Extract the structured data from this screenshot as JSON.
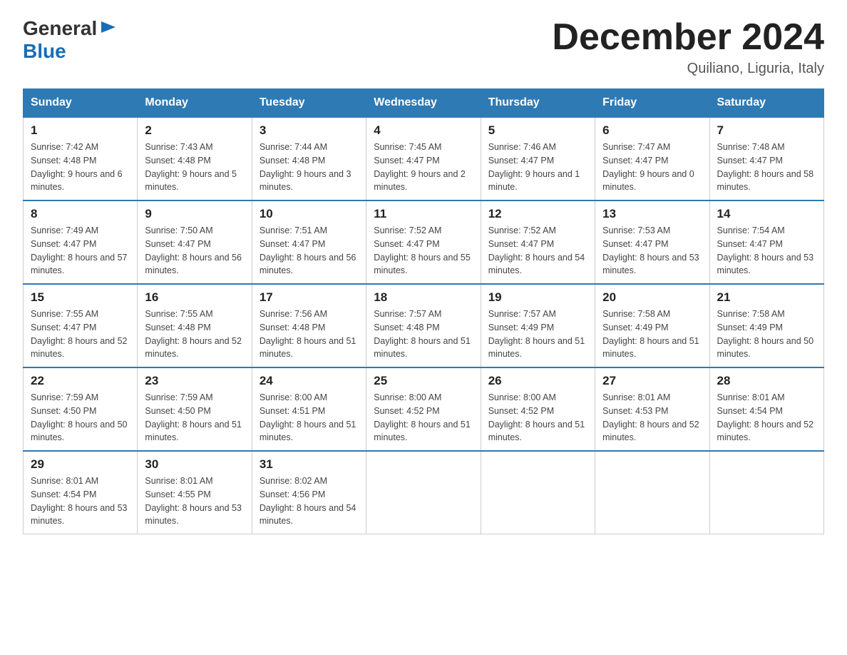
{
  "header": {
    "logo_general": "General",
    "logo_blue": "Blue",
    "month_title": "December 2024",
    "location": "Quiliano, Liguria, Italy"
  },
  "days_of_week": [
    "Sunday",
    "Monday",
    "Tuesday",
    "Wednesday",
    "Thursday",
    "Friday",
    "Saturday"
  ],
  "weeks": [
    [
      {
        "day": "1",
        "sunrise": "7:42 AM",
        "sunset": "4:48 PM",
        "daylight": "9 hours and 6 minutes."
      },
      {
        "day": "2",
        "sunrise": "7:43 AM",
        "sunset": "4:48 PM",
        "daylight": "9 hours and 5 minutes."
      },
      {
        "day": "3",
        "sunrise": "7:44 AM",
        "sunset": "4:48 PM",
        "daylight": "9 hours and 3 minutes."
      },
      {
        "day": "4",
        "sunrise": "7:45 AM",
        "sunset": "4:47 PM",
        "daylight": "9 hours and 2 minutes."
      },
      {
        "day": "5",
        "sunrise": "7:46 AM",
        "sunset": "4:47 PM",
        "daylight": "9 hours and 1 minute."
      },
      {
        "day": "6",
        "sunrise": "7:47 AM",
        "sunset": "4:47 PM",
        "daylight": "9 hours and 0 minutes."
      },
      {
        "day": "7",
        "sunrise": "7:48 AM",
        "sunset": "4:47 PM",
        "daylight": "8 hours and 58 minutes."
      }
    ],
    [
      {
        "day": "8",
        "sunrise": "7:49 AM",
        "sunset": "4:47 PM",
        "daylight": "8 hours and 57 minutes."
      },
      {
        "day": "9",
        "sunrise": "7:50 AM",
        "sunset": "4:47 PM",
        "daylight": "8 hours and 56 minutes."
      },
      {
        "day": "10",
        "sunrise": "7:51 AM",
        "sunset": "4:47 PM",
        "daylight": "8 hours and 56 minutes."
      },
      {
        "day": "11",
        "sunrise": "7:52 AM",
        "sunset": "4:47 PM",
        "daylight": "8 hours and 55 minutes."
      },
      {
        "day": "12",
        "sunrise": "7:52 AM",
        "sunset": "4:47 PM",
        "daylight": "8 hours and 54 minutes."
      },
      {
        "day": "13",
        "sunrise": "7:53 AM",
        "sunset": "4:47 PM",
        "daylight": "8 hours and 53 minutes."
      },
      {
        "day": "14",
        "sunrise": "7:54 AM",
        "sunset": "4:47 PM",
        "daylight": "8 hours and 53 minutes."
      }
    ],
    [
      {
        "day": "15",
        "sunrise": "7:55 AM",
        "sunset": "4:47 PM",
        "daylight": "8 hours and 52 minutes."
      },
      {
        "day": "16",
        "sunrise": "7:55 AM",
        "sunset": "4:48 PM",
        "daylight": "8 hours and 52 minutes."
      },
      {
        "day": "17",
        "sunrise": "7:56 AM",
        "sunset": "4:48 PM",
        "daylight": "8 hours and 51 minutes."
      },
      {
        "day": "18",
        "sunrise": "7:57 AM",
        "sunset": "4:48 PM",
        "daylight": "8 hours and 51 minutes."
      },
      {
        "day": "19",
        "sunrise": "7:57 AM",
        "sunset": "4:49 PM",
        "daylight": "8 hours and 51 minutes."
      },
      {
        "day": "20",
        "sunrise": "7:58 AM",
        "sunset": "4:49 PM",
        "daylight": "8 hours and 51 minutes."
      },
      {
        "day": "21",
        "sunrise": "7:58 AM",
        "sunset": "4:49 PM",
        "daylight": "8 hours and 50 minutes."
      }
    ],
    [
      {
        "day": "22",
        "sunrise": "7:59 AM",
        "sunset": "4:50 PM",
        "daylight": "8 hours and 50 minutes."
      },
      {
        "day": "23",
        "sunrise": "7:59 AM",
        "sunset": "4:50 PM",
        "daylight": "8 hours and 51 minutes."
      },
      {
        "day": "24",
        "sunrise": "8:00 AM",
        "sunset": "4:51 PM",
        "daylight": "8 hours and 51 minutes."
      },
      {
        "day": "25",
        "sunrise": "8:00 AM",
        "sunset": "4:52 PM",
        "daylight": "8 hours and 51 minutes."
      },
      {
        "day": "26",
        "sunrise": "8:00 AM",
        "sunset": "4:52 PM",
        "daylight": "8 hours and 51 minutes."
      },
      {
        "day": "27",
        "sunrise": "8:01 AM",
        "sunset": "4:53 PM",
        "daylight": "8 hours and 52 minutes."
      },
      {
        "day": "28",
        "sunrise": "8:01 AM",
        "sunset": "4:54 PM",
        "daylight": "8 hours and 52 minutes."
      }
    ],
    [
      {
        "day": "29",
        "sunrise": "8:01 AM",
        "sunset": "4:54 PM",
        "daylight": "8 hours and 53 minutes."
      },
      {
        "day": "30",
        "sunrise": "8:01 AM",
        "sunset": "4:55 PM",
        "daylight": "8 hours and 53 minutes."
      },
      {
        "day": "31",
        "sunrise": "8:02 AM",
        "sunset": "4:56 PM",
        "daylight": "8 hours and 54 minutes."
      },
      null,
      null,
      null,
      null
    ]
  ]
}
